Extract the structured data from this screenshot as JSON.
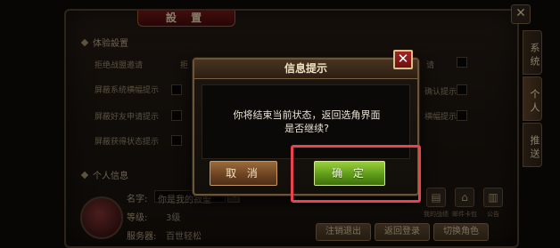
{
  "settings": {
    "title": "設 置",
    "close_icon": "✕",
    "side_tabs": [
      {
        "label": "系统"
      },
      {
        "label": "个人"
      },
      {
        "label": "推送"
      }
    ],
    "experience_section": "体验設置",
    "options_left": [
      "拒绝战盟邀请",
      "屏蔽系统横幅提示",
      "屏蔽好友申请提示",
      "屏蔽获得状态提示"
    ],
    "option_extra_1": "拒",
    "options_right": [
      "请",
      "确认提示",
      "横幅提示"
    ],
    "personal_section": "个人信息",
    "name_label": "名字:",
    "name_value": "你是我的寂聖",
    "level_label": "等级:",
    "level_value": "3级",
    "server_label": "服务器:",
    "server_value": "百世轻松",
    "icons": [
      {
        "icon": "battle-icon",
        "glyph": "▤",
        "label": "我的战绩"
      },
      {
        "icon": "mail-icon",
        "glyph": "⌂",
        "label": "邮件卡包"
      },
      {
        "icon": "notice-icon",
        "glyph": "▥",
        "label": "公告"
      }
    ],
    "buttons": [
      "注销退出",
      "返回登录",
      "切换角色"
    ]
  },
  "dialog": {
    "title": "信息提示",
    "message_line1": "你将结束当前状态，返回选角界面",
    "message_line2": "是否继续?",
    "cancel_label": "取 消",
    "confirm_label": "确 定",
    "close_icon": "✕"
  },
  "colors": {
    "confirm": "#5f9c18",
    "cancel": "#6e4423",
    "highlight": "#e8434e"
  }
}
